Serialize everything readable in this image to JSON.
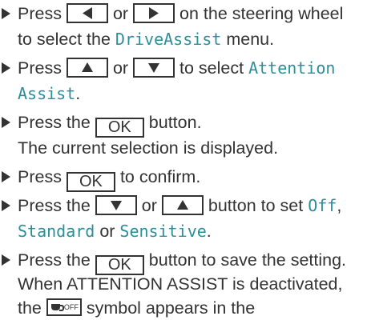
{
  "steps": [
    {
      "line1": {
        "pre": "Press",
        "or": "or",
        "post": "on the steering wheel"
      },
      "line2": {
        "pre": "to select the",
        "menu": "DriveAssist",
        "post": "menu."
      }
    },
    {
      "line1": {
        "pre": "Press",
        "or": "or",
        "post": "to select",
        "item_a": "Attention"
      },
      "line2": {
        "item_b": "Assist",
        "post": "."
      }
    },
    {
      "line1": {
        "pre": "Press the",
        "key": "OK",
        "post": "button."
      },
      "line2": {
        "text": "The current selection is displayed."
      }
    },
    {
      "line1": {
        "pre": "Press",
        "key": "OK",
        "post": "to confirm."
      }
    },
    {
      "line1": {
        "pre": "Press the",
        "or": "or",
        "post": "button to set",
        "opt1": "Off",
        "comma": ","
      },
      "line2": {
        "opt2": "Standard",
        "or": "or",
        "opt3": "Sensitive",
        "post": "."
      }
    },
    {
      "line1": {
        "pre": "Press the",
        "key": "OK",
        "post": "button to save the setting."
      },
      "line2": {
        "text": "When ATTENTION ASSIST is deactivated,"
      },
      "line3": {
        "pre": "the",
        "symbol_text": "OFF",
        "post": "symbol appears in the"
      }
    }
  ],
  "icons": {
    "bullet": "right-triangle-bullet",
    "left_key": "arrow-left-key",
    "right_key": "arrow-right-key",
    "up_key": "arrow-up-key",
    "down_key": "arrow-down-key",
    "symbol": "attention-assist-off-symbol"
  },
  "colors": {
    "text": "#333333",
    "display_text": "#2a8f9a"
  }
}
